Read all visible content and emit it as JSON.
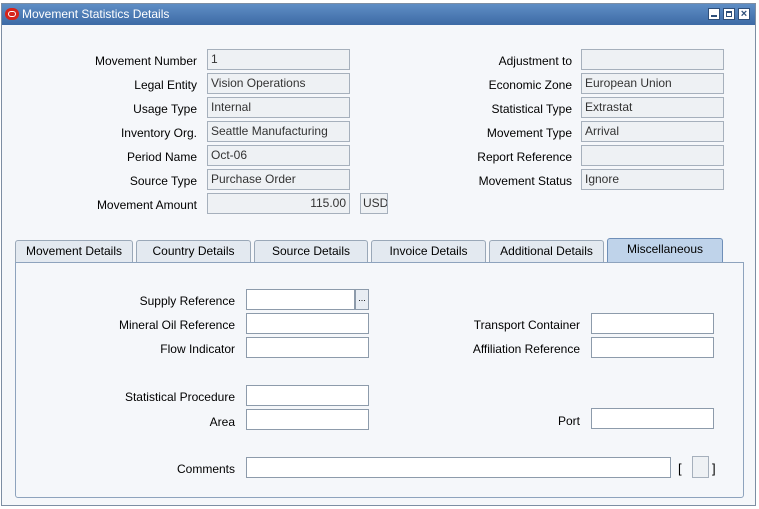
{
  "window": {
    "title": "Movement Statistics Details"
  },
  "header": {
    "movement_number": {
      "label": "Movement Number",
      "value": "1"
    },
    "legal_entity": {
      "label": "Legal Entity",
      "value": "Vision Operations"
    },
    "usage_type": {
      "label": "Usage Type",
      "value": "Internal"
    },
    "inventory_org": {
      "label": "Inventory Org.",
      "value": "Seattle Manufacturing"
    },
    "period_name": {
      "label": "Period Name",
      "value": "Oct-06"
    },
    "source_type": {
      "label": "Source Type",
      "value": "Purchase Order"
    },
    "movement_amount": {
      "label": "Movement Amount",
      "value": "115.00",
      "currency": "USD"
    },
    "adjustment_to": {
      "label": "Adjustment to",
      "value": ""
    },
    "economic_zone": {
      "label": "Economic Zone",
      "value": "European Union"
    },
    "statistical_type": {
      "label": "Statistical Type",
      "value": "Extrastat"
    },
    "movement_type": {
      "label": "Movement Type",
      "value": "Arrival"
    },
    "report_reference": {
      "label": "Report Reference",
      "value": ""
    },
    "movement_status": {
      "label": "Movement Status",
      "value": "Ignore"
    }
  },
  "tabs": [
    {
      "label": "Movement Details",
      "active": false
    },
    {
      "label": "Country Details",
      "active": false
    },
    {
      "label": "Source Details",
      "active": false
    },
    {
      "label": "Invoice Details",
      "active": false
    },
    {
      "label": "Additional Details",
      "active": false
    },
    {
      "label": "Miscellaneous",
      "active": true
    }
  ],
  "misc": {
    "supply_reference": {
      "label": "Supply Reference",
      "value": ""
    },
    "mineral_oil_reference": {
      "label": "Mineral Oil Reference",
      "value": ""
    },
    "flow_indicator": {
      "label": "Flow Indicator",
      "value": ""
    },
    "transport_container": {
      "label": "Transport Container",
      "value": ""
    },
    "affiliation_reference": {
      "label": "Affiliation Reference",
      "value": ""
    },
    "statistical_procedure": {
      "label": "Statistical Procedure",
      "value": ""
    },
    "area": {
      "label": "Area",
      "value": ""
    },
    "port": {
      "label": "Port",
      "value": ""
    },
    "comments": {
      "label": "Comments",
      "value": ""
    },
    "lov_glyph": "...",
    "bracket_open": "[",
    "bracket_close": "]"
  }
}
